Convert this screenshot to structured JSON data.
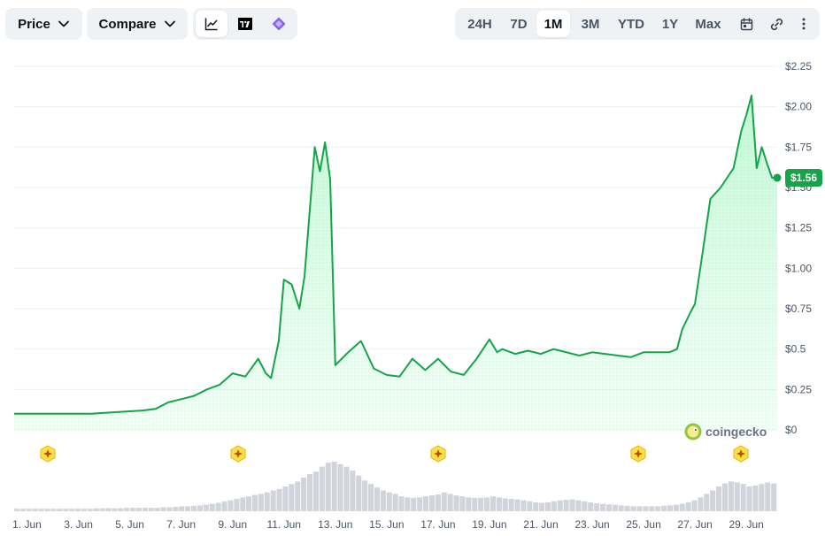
{
  "toolbar": {
    "price_label": "Price",
    "compare_label": "Compare",
    "view_icons": [
      "line-chart-icon",
      "tradingview-icon",
      "diamond-plugin-icon"
    ],
    "ranges": [
      "24H",
      "7D",
      "1M",
      "3M",
      "YTD",
      "1Y",
      "Max"
    ],
    "active_range": "1M",
    "right_icons": [
      "calendar-icon",
      "link-icon",
      "more-icon"
    ]
  },
  "current_price_label": "$1.56",
  "watermark": "coingecko",
  "colors": {
    "line": "#16a34a",
    "fill": "#dcfce7",
    "volume": "#d1d5db",
    "event": "#fde047"
  },
  "chart_data": {
    "type": "area",
    "x_ticks": [
      "1. Jun",
      "3. Jun",
      "5. Jun",
      "7. Jun",
      "9. Jun",
      "11. Jun",
      "13. Jun",
      "15. Jun",
      "17. Jun",
      "19. Jun",
      "21. Jun",
      "23. Jun",
      "25. Jun",
      "27. Jun",
      "29. Jun"
    ],
    "y_ticks": [
      "$0",
      "$0.25",
      "$0.5",
      "$0.75",
      "$1.00",
      "$1.25",
      "$1.50",
      "$1.75",
      "$2.00",
      "$2.25"
    ],
    "ylim": [
      0,
      2.25
    ],
    "xlim": [
      0.5,
      30.2
    ],
    "grid": true,
    "series": [
      {
        "x": [
          0.5,
          1.5,
          2.5,
          3.5,
          4.5,
          5.5,
          6.0,
          6.5,
          7.0,
          7.5,
          8.0,
          8.5,
          9.0,
          9.5,
          10.0,
          10.3,
          10.5,
          10.8,
          11.0,
          11.3,
          11.6,
          11.8,
          12.0,
          12.2,
          12.4,
          12.6,
          12.8,
          13.0,
          13.5,
          14.0,
          14.5,
          15.0,
          15.5,
          16.0,
          16.5,
          17.0,
          17.5,
          18.0,
          18.5,
          19.0,
          19.3,
          19.5,
          20.0,
          20.5,
          21.0,
          21.5,
          22.0,
          22.5,
          23.0,
          23.5,
          24.0,
          24.5,
          25.0,
          25.5,
          26.0,
          26.3,
          26.5,
          26.8,
          27.0,
          27.3,
          27.6,
          28.0,
          28.5,
          28.8,
          29.0,
          29.2,
          29.4,
          29.6,
          29.8,
          30.0,
          30.2
        ],
        "y": [
          0.1,
          0.1,
          0.1,
          0.1,
          0.11,
          0.12,
          0.13,
          0.17,
          0.19,
          0.21,
          0.25,
          0.28,
          0.35,
          0.33,
          0.44,
          0.35,
          0.32,
          0.55,
          0.93,
          0.9,
          0.75,
          0.95,
          1.35,
          1.75,
          1.6,
          1.78,
          1.55,
          0.4,
          0.48,
          0.55,
          0.38,
          0.34,
          0.33,
          0.44,
          0.37,
          0.44,
          0.36,
          0.34,
          0.44,
          0.56,
          0.48,
          0.5,
          0.47,
          0.49,
          0.47,
          0.5,
          0.48,
          0.46,
          0.48,
          0.47,
          0.46,
          0.45,
          0.48,
          0.48,
          0.48,
          0.5,
          0.62,
          0.72,
          0.78,
          1.1,
          1.43,
          1.5,
          1.62,
          1.85,
          1.95,
          2.07,
          1.62,
          1.75,
          1.65,
          1.56,
          1.56
        ]
      }
    ],
    "volume": [
      0.05,
      0.05,
      0.05,
      0.05,
      0.05,
      0.05,
      0.05,
      0.05,
      0.05,
      0.05,
      0.05,
      0.05,
      0.05,
      0.06,
      0.06,
      0.06,
      0.06,
      0.06,
      0.07,
      0.07,
      0.07,
      0.07,
      0.07,
      0.07,
      0.08,
      0.08,
      0.09,
      0.1,
      0.1,
      0.11,
      0.12,
      0.13,
      0.15,
      0.17,
      0.2,
      0.22,
      0.25,
      0.28,
      0.3,
      0.33,
      0.35,
      0.38,
      0.42,
      0.45,
      0.5,
      0.55,
      0.6,
      0.68,
      0.75,
      0.8,
      0.9,
      0.98,
      1.0,
      0.95,
      0.9,
      0.82,
      0.72,
      0.62,
      0.55,
      0.48,
      0.42,
      0.38,
      0.35,
      0.3,
      0.28,
      0.27,
      0.28,
      0.3,
      0.32,
      0.34,
      0.38,
      0.35,
      0.32,
      0.3,
      0.28,
      0.27,
      0.27,
      0.28,
      0.3,
      0.28,
      0.26,
      0.25,
      0.24,
      0.22,
      0.2,
      0.18,
      0.17,
      0.18,
      0.2,
      0.22,
      0.23,
      0.24,
      0.22,
      0.2,
      0.18,
      0.16,
      0.15,
      0.14,
      0.13,
      0.12,
      0.11,
      0.1,
      0.1,
      0.1,
      0.1,
      0.1,
      0.11,
      0.12,
      0.13,
      0.15,
      0.18,
      0.22,
      0.28,
      0.35,
      0.42,
      0.5,
      0.56,
      0.6,
      0.58,
      0.55,
      0.5,
      0.52,
      0.55,
      0.58,
      0.56
    ],
    "event_markers_x": [
      1.8,
      9.2,
      17.0,
      24.8,
      28.8
    ]
  }
}
